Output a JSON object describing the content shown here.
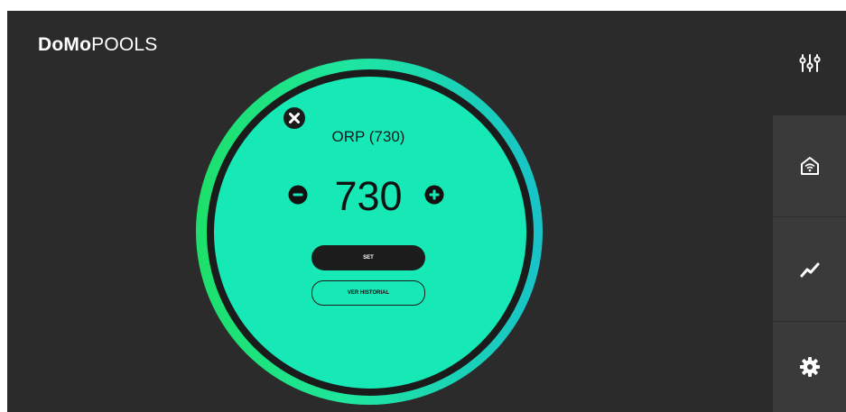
{
  "app": {
    "brand_bold": "DoMo",
    "brand_light": "POOLS"
  },
  "sidebar": {
    "items": [
      {
        "icon": "sliders-icon"
      },
      {
        "icon": "home-wifi-icon"
      },
      {
        "icon": "trend-chart-icon"
      },
      {
        "icon": "gear-icon"
      }
    ]
  },
  "dial": {
    "title": "ORP (730)",
    "value": "730",
    "set_label": "SET",
    "history_label": "VER HISTORIAL"
  },
  "colors": {
    "background": "#2b2b2b",
    "sidebar_panel": "#3a3a3a",
    "dial_face": "#16e9b6",
    "ring_start": "#1de06a",
    "ring_end": "#18c3c8",
    "dark": "#1b1b1b",
    "text_light": "#ffffff"
  }
}
